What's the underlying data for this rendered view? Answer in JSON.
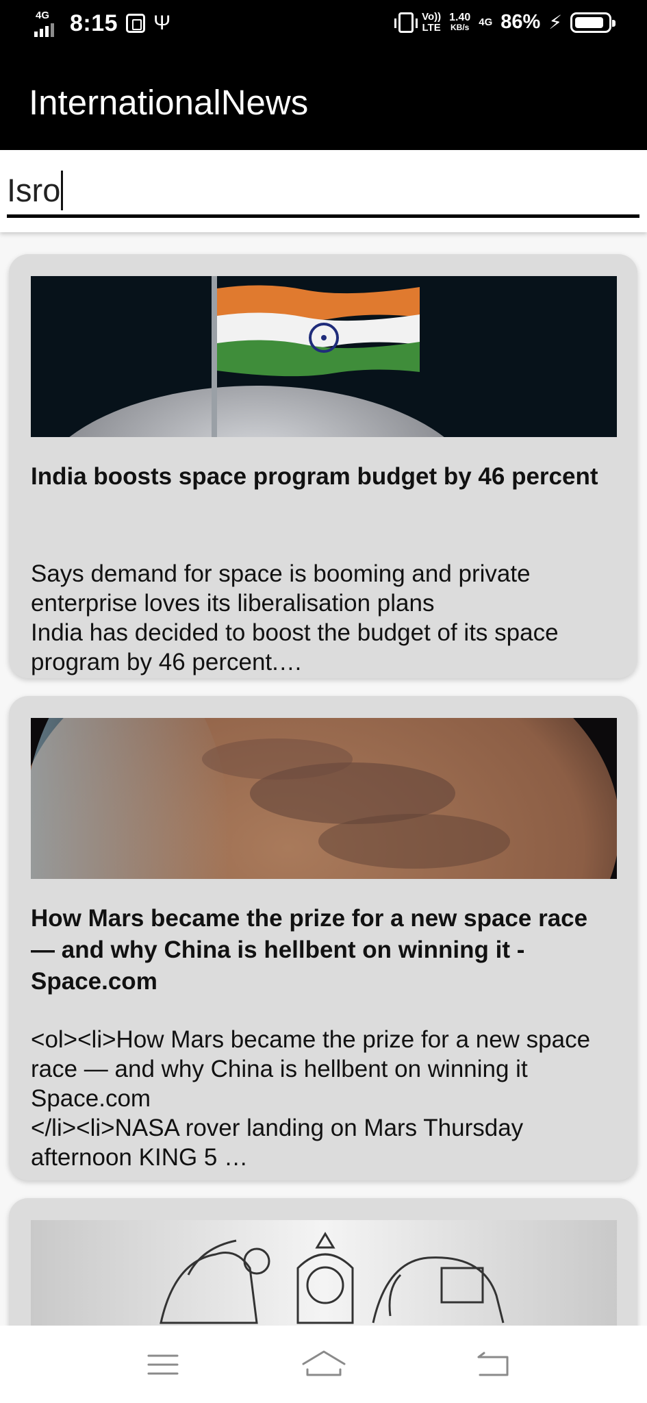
{
  "status_bar": {
    "network_type": "4G",
    "time": "8:15",
    "volte_top": "Vo))",
    "volte_bottom": "LTE",
    "speed_value": "1.40",
    "speed_unit": "KB/s",
    "network_type_2": "4G",
    "battery_percent": "86%",
    "battery_level": 0.86,
    "icons": [
      "signal-icon",
      "usb-settings-icon",
      "usb-icon",
      "vibrate-icon",
      "charging-icon",
      "battery-icon"
    ]
  },
  "app_bar": {
    "title": "InternationalNews"
  },
  "search": {
    "value": "Isro"
  },
  "articles": [
    {
      "title": "India boosts space program budget by 46 percent",
      "description": "Says demand for space is booming and private enterprise loves its liberalisation plans\nIndia has decided to boost the budget of its space program by 46 percent.…"
    },
    {
      "title": "How Mars became the prize for a new space race — and why China is hellbent on winning it - Space.com",
      "description": "<ol><li>How Mars became the prize for a new space race — and why China is hellbent on winning it  Space.com\n</li><li>NASA rover landing on Mars Thursday afternoon  KING 5 …"
    },
    {
      "title": "",
      "description": ""
    }
  ],
  "nav_bar": {
    "icons": [
      "menu-icon",
      "home-icon",
      "back-icon"
    ]
  }
}
